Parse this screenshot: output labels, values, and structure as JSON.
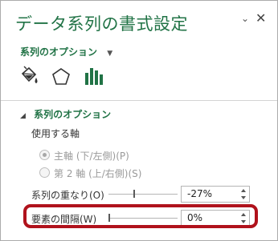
{
  "pane": {
    "title": "データ系列の書式設定",
    "pin_glyph": "⌄",
    "close_glyph": "✕"
  },
  "options_dropdown": {
    "label": "系列のオプション",
    "caret": "▼"
  },
  "icon_tabs": [
    {
      "name": "fill-line-icon",
      "selected": false
    },
    {
      "name": "effects-pentagon-icon",
      "selected": false
    },
    {
      "name": "series-options-bars-icon",
      "selected": true
    }
  ],
  "section": {
    "title": "系列のオプション",
    "collapse_glyph": "◢",
    "axis_label": "使用する軸",
    "radios": [
      {
        "label": "主軸 (下/左側)(P)",
        "checked": true,
        "enabled": false
      },
      {
        "label": "第 2 軸 (上/右側)(S)",
        "checked": false,
        "enabled": false
      }
    ],
    "overlap": {
      "label": "系列の重なり(O)",
      "value": "-27%",
      "level": 0.365
    },
    "gap_width": {
      "label": "要素の間隔(W)",
      "value": "0%",
      "level": 0.0
    }
  },
  "colors": {
    "accent": "#217346",
    "highlight": "#b0121c"
  }
}
